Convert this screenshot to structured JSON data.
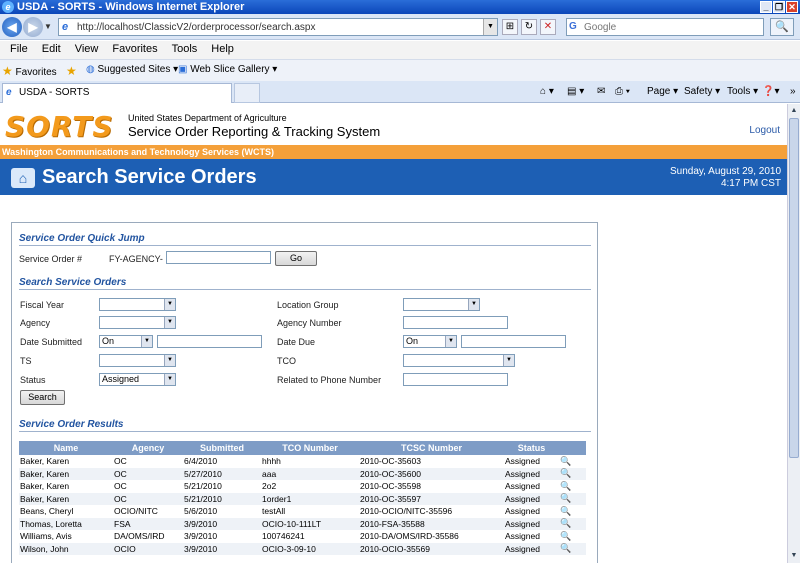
{
  "window": {
    "title": "USDA - SORTS - Windows Internet Explorer"
  },
  "browser": {
    "url": "http://localhost/ClassicV2/orderprocessor/search.aspx",
    "search_placeholder": "Google",
    "menu": [
      "File",
      "Edit",
      "View",
      "Favorites",
      "Tools",
      "Help"
    ],
    "favorites_label": "Favorites",
    "fav_links": [
      "Suggested Sites ▾",
      "Web Slice Gallery ▾"
    ],
    "tab_title": "USDA - SORTS",
    "commands": [
      "Page ▾",
      "Safety ▾",
      "Tools ▾"
    ]
  },
  "header": {
    "logo": "SORTS",
    "agency": "United States Department of Agriculture",
    "system": "Service Order Reporting & Tracking System",
    "logout": "Logout",
    "org_bar": "Washington Communications and Technology Services (WCTS)",
    "page_title": "Search Service Orders",
    "date": "Sunday, August 29, 2010",
    "time": "4:17 PM CST"
  },
  "quick_jump": {
    "heading": "Service Order Quick Jump",
    "label": "Service Order #",
    "prefix": "FY-AGENCY-",
    "value": "",
    "go": "Go"
  },
  "search": {
    "heading": "Search Service Orders",
    "fiscal_year": {
      "label": "Fiscal Year",
      "value": ""
    },
    "agency": {
      "label": "Agency",
      "value": ""
    },
    "date_submitted": {
      "label": "Date Submitted",
      "op": "On",
      "value": ""
    },
    "ts": {
      "label": "TS",
      "value": ""
    },
    "status": {
      "label": "Status",
      "value": "Assigned"
    },
    "location_group": {
      "label": "Location Group",
      "value": ""
    },
    "agency_number": {
      "label": "Agency Number",
      "value": ""
    },
    "date_due": {
      "label": "Date Due",
      "op": "On",
      "value": ""
    },
    "tco": {
      "label": "TCO",
      "value": ""
    },
    "phone": {
      "label": "Related to Phone Number",
      "value": ""
    },
    "button": "Search"
  },
  "results": {
    "heading": "Service Order Results",
    "columns": [
      "Name",
      "Agency",
      "Submitted",
      "TCO Number",
      "TCSC Number",
      "Status"
    ],
    "rows": [
      [
        "Baker, Karen",
        "OC",
        "6/4/2010",
        "hhhh",
        "2010-OC-35603",
        "Assigned"
      ],
      [
        "Baker, Karen",
        "OC",
        "5/27/2010",
        "aaa",
        "2010-OC-35600",
        "Assigned"
      ],
      [
        "Baker, Karen",
        "OC",
        "5/21/2010",
        "2o2",
        "2010-OC-35598",
        "Assigned"
      ],
      [
        "Baker, Karen",
        "OC",
        "5/21/2010",
        "1order1",
        "2010-OC-35597",
        "Assigned"
      ],
      [
        "Beans, Cheryl",
        "OCIO/NITC",
        "5/6/2010",
        "testAll",
        "2010-OCIO/NITC-35596",
        "Assigned"
      ],
      [
        "Thomas, Loretta",
        "FSA",
        "3/9/2010",
        "OCIO-10-111LT",
        "2010-FSA-35588",
        "Assigned"
      ],
      [
        "Williams, Avis",
        "DA/OMS/IRD",
        "3/9/2010",
        "100746241",
        "2010-DA/OMS/IRD-35586",
        "Assigned"
      ],
      [
        "Wilson, John",
        "OCIO",
        "3/9/2010",
        "OCIO-3-09-10",
        "2010-OCIO-35569",
        "Assigned"
      ]
    ]
  }
}
